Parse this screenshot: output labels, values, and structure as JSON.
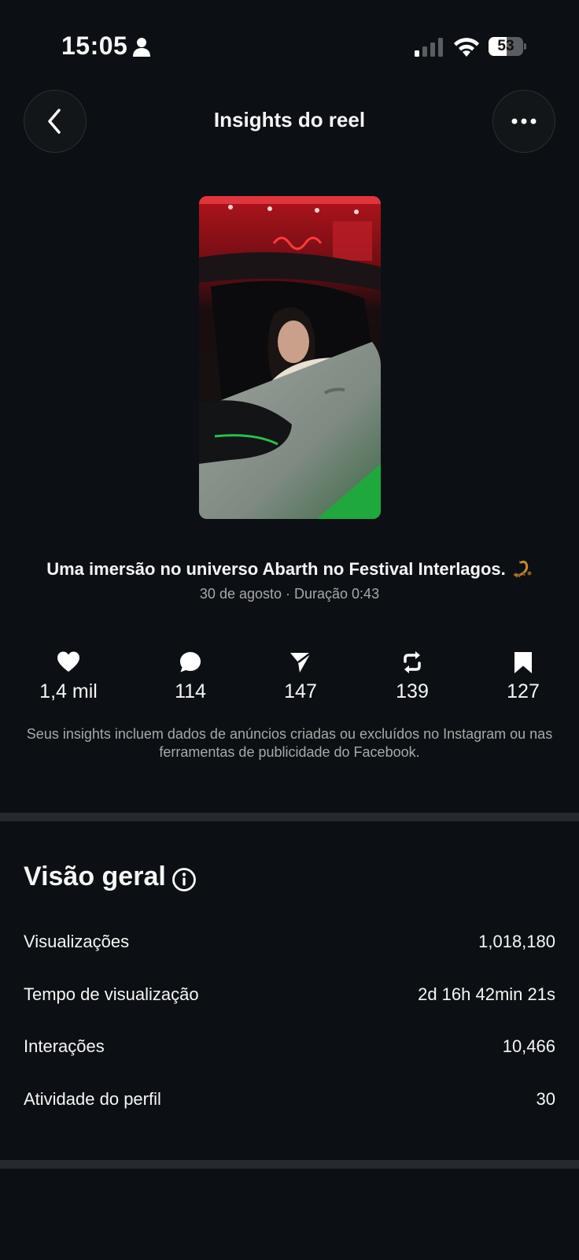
{
  "status_bar": {
    "time": "15:05",
    "battery": "53",
    "battery_level": 0.53
  },
  "header": {
    "title": "Insights do reel",
    "back_icon": "chevron-left-icon",
    "more_icon": "more-horizontal-icon"
  },
  "post": {
    "caption": "Uma imersão no universo Abarth no Festival Interlagos.",
    "caption_emoji": "scorpion",
    "meta": "30 de agosto · Duração 0:43"
  },
  "stats": [
    {
      "icon": "heart-icon",
      "value": "1,4 mil"
    },
    {
      "icon": "comment-icon",
      "value": "114"
    },
    {
      "icon": "share-icon",
      "value": "147"
    },
    {
      "icon": "repost-icon",
      "value": "139"
    },
    {
      "icon": "bookmark-icon",
      "value": "127"
    }
  ],
  "disclaimer": "Seus insights incluem dados de anúncios criadas ou excluídos no Instagram ou nas ferramentas de publicidade do Facebook.",
  "overview": {
    "title": "Visão geral",
    "rows": [
      {
        "label": "Visualizações",
        "value": "1,018,180"
      },
      {
        "label": "Tempo de visualização",
        "value": "2d 16h 42min 21s"
      },
      {
        "label": "Interações",
        "value": "10,466"
      },
      {
        "label": "Atividade do perfil",
        "value": "30"
      }
    ]
  },
  "colors": {
    "background": "#0c1014",
    "secondary_text": "#a8a8a8",
    "divider": "#262a2f"
  }
}
